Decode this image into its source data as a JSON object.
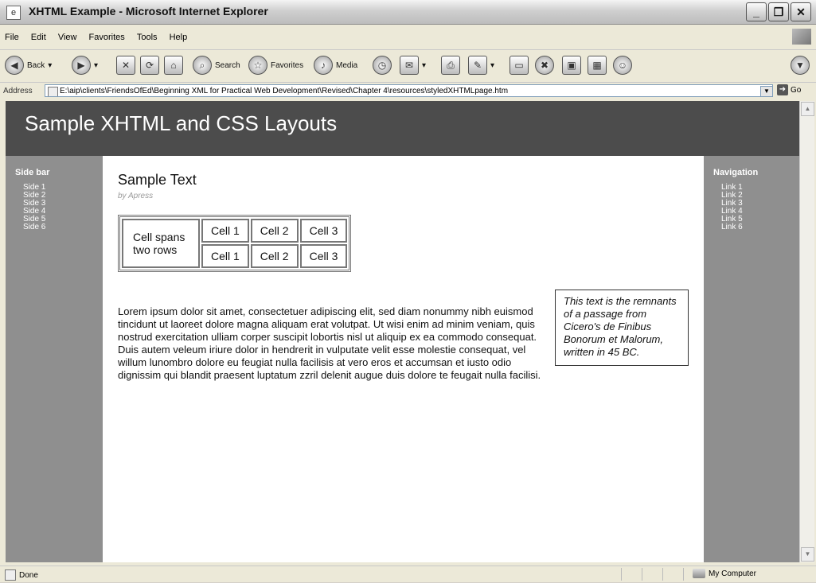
{
  "window": {
    "title": "XHTML Example - Microsoft Internet Explorer",
    "buttons": [
      "_",
      "❐",
      "✕"
    ]
  },
  "menu": [
    "File",
    "Edit",
    "View",
    "Favorites",
    "Tools",
    "Help"
  ],
  "toolbar": {
    "back": "Back",
    "search": "Search",
    "favorites": "Favorites",
    "media": "Media"
  },
  "address": {
    "label": "Address",
    "url": "E:\\aip\\clients\\FriendsOfEd\\Beginning XML for Practical Web Development\\Revised\\Chapter 4\\resources\\styledXHTMLpage.htm",
    "go": "Go"
  },
  "page": {
    "header_title": "Sample XHTML and CSS Layouts",
    "sidebar": {
      "heading": "Side bar",
      "items": [
        "Side 1",
        "Side 2",
        "Side 3",
        "Side 4",
        "Side 5",
        "Side 6"
      ]
    },
    "navigation": {
      "heading": "Navigation",
      "items": [
        "Link 1",
        "Link 2",
        "Link 3",
        "Link 4",
        "Link 5",
        "Link 6"
      ]
    },
    "main": {
      "heading": "Sample Text",
      "byline": "by Apress",
      "table": {
        "span_cell": "Cell spans two rows",
        "row1": [
          "Cell 1",
          "Cell 2",
          "Cell 3"
        ],
        "row2": [
          "Cell 1",
          "Cell 2",
          "Cell 3"
        ]
      },
      "paragraph": "Lorem ipsum dolor sit amet, consectetuer adipiscing elit, sed diam nonummy nibh euismod tincidunt ut laoreet dolore magna aliquam erat volutpat. Ut wisi enim ad minim veniam, quis nostrud exercitation ulliam corper suscipit lobortis nisl ut aliquip ex ea commodo consequat. Duis autem veleum iriure dolor in hendrerit in vulputate velit esse molestie consequat, vel willum lunombro dolore eu feugiat nulla facilisis at vero eros et accumsan et iusto odio dignissim qui blandit praesent luptatum zzril delenit augue duis dolore te feugait nulla facilisi.",
      "pullquote": "This text is the remnants of a passage from Cicero's de Finibus Bonorum et Malorum, written in 45 BC."
    }
  },
  "status": {
    "left": "Done",
    "zone": "My Computer"
  }
}
